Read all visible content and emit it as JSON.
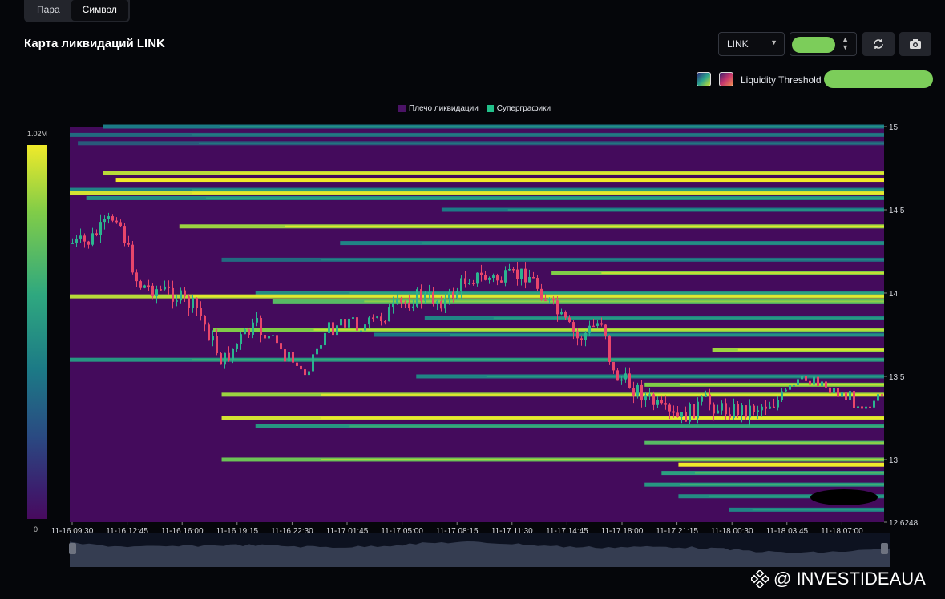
{
  "tabs": [
    "Пара",
    "Символ"
  ],
  "active_tab": 1,
  "title": "Карта ликвидаций LINK",
  "controls": {
    "symbol": "LINK",
    "liquidity_threshold_label": "Liquidity Threshold"
  },
  "colors": {
    "background": "#440b5c",
    "low": "#480a5e",
    "mid": "#2fa87f",
    "high": "#f0ea2a",
    "up": "#2bb48f",
    "down": "#e8466b"
  },
  "watermark": "@ INVESTIDEAUA",
  "chart_data": {
    "type": "heatmap",
    "legend": [
      {
        "name": "Плечо ликвидации",
        "color": "#4b1366"
      },
      {
        "name": "Суперграфики",
        "color": "#22c08a"
      }
    ],
    "colorbar": {
      "min_label": "0",
      "max_label": "1.02M",
      "min": 0,
      "max": 1020000
    },
    "y_ticks": [
      "15",
      "14.5",
      "14",
      "13.5",
      "13",
      "12.6248"
    ],
    "ylim": [
      12.6248,
      15
    ],
    "x_ticks": [
      "11-16 09:30",
      "11-16 12:45",
      "11-16 16:00",
      "11-16 19:15",
      "11-16 22:30",
      "11-17 01:45",
      "11-17 05:00",
      "11-17 08:15",
      "11-17 11:30",
      "11-17 14:45",
      "11-17 18:00",
      "11-17 21:15",
      "11-18 00:30",
      "11-18 03:45",
      "11-18 07:00"
    ],
    "liquidation_levels": [
      {
        "price": 15.0,
        "start": "11-16 12:00",
        "intensity": 0.35
      },
      {
        "price": 14.95,
        "start": "11-16 09:30",
        "intensity": 0.3
      },
      {
        "price": 14.9,
        "start": "11-16 10:30",
        "intensity": 0.25
      },
      {
        "price": 14.72,
        "start": "11-16 12:00",
        "intensity": 0.9
      },
      {
        "price": 14.68,
        "start": "11-16 12:45",
        "intensity": 1.0
      },
      {
        "price": 14.62,
        "start": "11-16 09:30",
        "intensity": 0.4
      },
      {
        "price": 14.6,
        "start": "11-16 10:00",
        "intensity": 0.95
      },
      {
        "price": 14.57,
        "start": "11-16 11:00",
        "intensity": 0.45
      },
      {
        "price": 14.5,
        "start": "11-17 08:00",
        "intensity": 0.35
      },
      {
        "price": 14.4,
        "start": "11-16 16:30",
        "intensity": 0.85
      },
      {
        "price": 14.3,
        "start": "11-17 02:00",
        "intensity": 0.4
      },
      {
        "price": 14.2,
        "start": "11-16 19:00",
        "intensity": 0.3
      },
      {
        "price": 14.12,
        "start": "11-17 14:30",
        "intensity": 0.8
      },
      {
        "price": 14.0,
        "start": "11-16 21:00",
        "intensity": 0.45
      },
      {
        "price": 13.98,
        "start": "11-16 09:30",
        "intensity": 0.9
      },
      {
        "price": 13.95,
        "start": "11-16 22:00",
        "intensity": 0.7
      },
      {
        "price": 13.85,
        "start": "11-17 07:00",
        "intensity": 0.4
      },
      {
        "price": 13.78,
        "start": "11-16 18:30",
        "intensity": 0.8
      },
      {
        "price": 13.75,
        "start": "11-17 04:00",
        "intensity": 0.35
      },
      {
        "price": 13.66,
        "start": "11-18 00:00",
        "intensity": 0.85
      },
      {
        "price": 13.6,
        "start": "11-16 09:30",
        "intensity": 0.5
      },
      {
        "price": 13.5,
        "start": "11-17 06:30",
        "intensity": 0.4
      },
      {
        "price": 13.45,
        "start": "11-17 20:00",
        "intensity": 0.8
      },
      {
        "price": 13.39,
        "start": "11-16 19:00",
        "intensity": 0.85
      },
      {
        "price": 13.25,
        "start": "11-16 19:00",
        "intensity": 0.95
      },
      {
        "price": 13.2,
        "start": "11-16 21:00",
        "intensity": 0.5
      },
      {
        "price": 13.1,
        "start": "11-17 20:00",
        "intensity": 0.7
      },
      {
        "price": 13.0,
        "start": "11-16 19:00",
        "intensity": 0.75
      },
      {
        "price": 12.97,
        "start": "11-17 22:00",
        "intensity": 1.0
      },
      {
        "price": 12.92,
        "start": "11-17 21:00",
        "intensity": 0.55
      },
      {
        "price": 12.85,
        "start": "11-17 20:00",
        "intensity": 0.5
      },
      {
        "price": 12.78,
        "start": "11-17 22:00",
        "intensity": 0.45
      },
      {
        "price": 12.7,
        "start": "11-18 01:00",
        "intensity": 0.4
      }
    ],
    "price_path": [
      [
        "11-16 09:30",
        14.3
      ],
      [
        "11-16 11:00",
        14.3
      ],
      [
        "11-16 12:45",
        14.48
      ],
      [
        "11-16 14:00",
        14.05
      ],
      [
        "11-16 16:00",
        14.0
      ],
      [
        "11-16 17:30",
        13.9
      ],
      [
        "11-16 19:00",
        13.58
      ],
      [
        "11-16 20:00",
        13.72
      ],
      [
        "11-16 21:00",
        13.8
      ],
      [
        "11-16 22:30",
        13.65
      ],
      [
        "11-16 23:45",
        13.52
      ],
      [
        "11-17 01:00",
        13.75
      ],
      [
        "11-17 02:00",
        13.85
      ],
      [
        "11-17 03:30",
        13.8
      ],
      [
        "11-17 05:00",
        13.9
      ],
      [
        "11-17 06:30",
        13.98
      ],
      [
        "11-17 08:15",
        13.95
      ],
      [
        "11-17 09:30",
        14.1
      ],
      [
        "11-17 11:30",
        14.08
      ],
      [
        "11-17 13:00",
        14.12
      ],
      [
        "11-17 14:45",
        13.88
      ],
      [
        "11-17 16:00",
        13.72
      ],
      [
        "11-17 17:30",
        13.85
      ],
      [
        "11-17 18:00",
        13.52
      ],
      [
        "11-17 19:30",
        13.42
      ],
      [
        "11-17 21:15",
        13.27
      ],
      [
        "11-17 22:00",
        13.24
      ],
      [
        "11-17 23:30",
        13.35
      ],
      [
        "11-18 00:30",
        13.3
      ],
      [
        "11-18 02:00",
        13.3
      ],
      [
        "11-18 03:45",
        13.35
      ],
      [
        "11-18 05:00",
        13.45
      ],
      [
        "11-18 06:00",
        13.5
      ],
      [
        "11-18 07:00",
        13.42
      ],
      [
        "11-18 08:30",
        13.35
      ]
    ]
  }
}
